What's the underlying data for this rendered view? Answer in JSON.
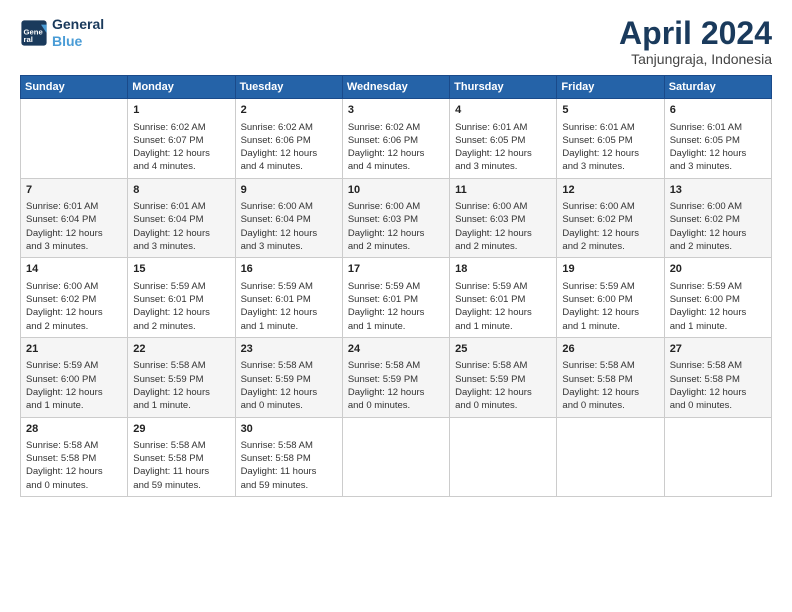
{
  "header": {
    "logo_line1": "General",
    "logo_line2": "Blue",
    "month_year": "April 2024",
    "location": "Tanjungraja, Indonesia"
  },
  "days_of_week": [
    "Sunday",
    "Monday",
    "Tuesday",
    "Wednesday",
    "Thursday",
    "Friday",
    "Saturday"
  ],
  "weeks": [
    [
      {
        "day": "",
        "data": ""
      },
      {
        "day": "1",
        "data": "Sunrise: 6:02 AM\nSunset: 6:07 PM\nDaylight: 12 hours\nand 4 minutes."
      },
      {
        "day": "2",
        "data": "Sunrise: 6:02 AM\nSunset: 6:06 PM\nDaylight: 12 hours\nand 4 minutes."
      },
      {
        "day": "3",
        "data": "Sunrise: 6:02 AM\nSunset: 6:06 PM\nDaylight: 12 hours\nand 4 minutes."
      },
      {
        "day": "4",
        "data": "Sunrise: 6:01 AM\nSunset: 6:05 PM\nDaylight: 12 hours\nand 3 minutes."
      },
      {
        "day": "5",
        "data": "Sunrise: 6:01 AM\nSunset: 6:05 PM\nDaylight: 12 hours\nand 3 minutes."
      },
      {
        "day": "6",
        "data": "Sunrise: 6:01 AM\nSunset: 6:05 PM\nDaylight: 12 hours\nand 3 minutes."
      }
    ],
    [
      {
        "day": "7",
        "data": "Sunrise: 6:01 AM\nSunset: 6:04 PM\nDaylight: 12 hours\nand 3 minutes."
      },
      {
        "day": "8",
        "data": "Sunrise: 6:01 AM\nSunset: 6:04 PM\nDaylight: 12 hours\nand 3 minutes."
      },
      {
        "day": "9",
        "data": "Sunrise: 6:00 AM\nSunset: 6:04 PM\nDaylight: 12 hours\nand 3 minutes."
      },
      {
        "day": "10",
        "data": "Sunrise: 6:00 AM\nSunset: 6:03 PM\nDaylight: 12 hours\nand 2 minutes."
      },
      {
        "day": "11",
        "data": "Sunrise: 6:00 AM\nSunset: 6:03 PM\nDaylight: 12 hours\nand 2 minutes."
      },
      {
        "day": "12",
        "data": "Sunrise: 6:00 AM\nSunset: 6:02 PM\nDaylight: 12 hours\nand 2 minutes."
      },
      {
        "day": "13",
        "data": "Sunrise: 6:00 AM\nSunset: 6:02 PM\nDaylight: 12 hours\nand 2 minutes."
      }
    ],
    [
      {
        "day": "14",
        "data": "Sunrise: 6:00 AM\nSunset: 6:02 PM\nDaylight: 12 hours\nand 2 minutes."
      },
      {
        "day": "15",
        "data": "Sunrise: 5:59 AM\nSunset: 6:01 PM\nDaylight: 12 hours\nand 2 minutes."
      },
      {
        "day": "16",
        "data": "Sunrise: 5:59 AM\nSunset: 6:01 PM\nDaylight: 12 hours\nand 1 minute."
      },
      {
        "day": "17",
        "data": "Sunrise: 5:59 AM\nSunset: 6:01 PM\nDaylight: 12 hours\nand 1 minute."
      },
      {
        "day": "18",
        "data": "Sunrise: 5:59 AM\nSunset: 6:01 PM\nDaylight: 12 hours\nand 1 minute."
      },
      {
        "day": "19",
        "data": "Sunrise: 5:59 AM\nSunset: 6:00 PM\nDaylight: 12 hours\nand 1 minute."
      },
      {
        "day": "20",
        "data": "Sunrise: 5:59 AM\nSunset: 6:00 PM\nDaylight: 12 hours\nand 1 minute."
      }
    ],
    [
      {
        "day": "21",
        "data": "Sunrise: 5:59 AM\nSunset: 6:00 PM\nDaylight: 12 hours\nand 1 minute."
      },
      {
        "day": "22",
        "data": "Sunrise: 5:58 AM\nSunset: 5:59 PM\nDaylight: 12 hours\nand 1 minute."
      },
      {
        "day": "23",
        "data": "Sunrise: 5:58 AM\nSunset: 5:59 PM\nDaylight: 12 hours\nand 0 minutes."
      },
      {
        "day": "24",
        "data": "Sunrise: 5:58 AM\nSunset: 5:59 PM\nDaylight: 12 hours\nand 0 minutes."
      },
      {
        "day": "25",
        "data": "Sunrise: 5:58 AM\nSunset: 5:59 PM\nDaylight: 12 hours\nand 0 minutes."
      },
      {
        "day": "26",
        "data": "Sunrise: 5:58 AM\nSunset: 5:58 PM\nDaylight: 12 hours\nand 0 minutes."
      },
      {
        "day": "27",
        "data": "Sunrise: 5:58 AM\nSunset: 5:58 PM\nDaylight: 12 hours\nand 0 minutes."
      }
    ],
    [
      {
        "day": "28",
        "data": "Sunrise: 5:58 AM\nSunset: 5:58 PM\nDaylight: 12 hours\nand 0 minutes."
      },
      {
        "day": "29",
        "data": "Sunrise: 5:58 AM\nSunset: 5:58 PM\nDaylight: 11 hours\nand 59 minutes."
      },
      {
        "day": "30",
        "data": "Sunrise: 5:58 AM\nSunset: 5:58 PM\nDaylight: 11 hours\nand 59 minutes."
      },
      {
        "day": "",
        "data": ""
      },
      {
        "day": "",
        "data": ""
      },
      {
        "day": "",
        "data": ""
      },
      {
        "day": "",
        "data": ""
      }
    ]
  ]
}
